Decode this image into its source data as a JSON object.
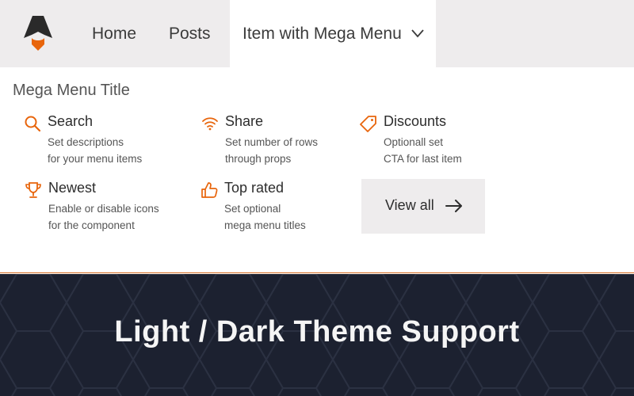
{
  "nav": {
    "logo": "astro-logo",
    "items": [
      {
        "label": "Home"
      },
      {
        "label": "Posts"
      },
      {
        "label": "Item with Mega Menu"
      }
    ]
  },
  "mega_menu": {
    "title": "Mega Menu Title",
    "items": [
      {
        "label": "Search",
        "desc": [
          "Set descriptions",
          "for your menu items"
        ],
        "icon": "search-icon"
      },
      {
        "label": "Share",
        "desc": [
          "Set number of rows",
          "through props"
        ],
        "icon": "wifi-icon"
      },
      {
        "label": "Discounts",
        "desc": [
          "Optionall set",
          "CTA for last item"
        ],
        "icon": "tag-icon"
      },
      {
        "label": "Newest",
        "desc": [
          "Enable or disable icons",
          "for the component"
        ],
        "icon": "trophy-icon"
      },
      {
        "label": "Top rated",
        "desc": [
          "Set optional",
          "mega menu titles"
        ],
        "icon": "thumbs-up-icon"
      }
    ],
    "cta": {
      "label": "View all",
      "icon": "arrow-right-icon"
    }
  },
  "hero": {
    "title": "Light / Dark Theme Support"
  },
  "colors": {
    "accent": "#e8650c",
    "nav_bg": "#eeeced",
    "hero_bg": "#1c2130"
  }
}
